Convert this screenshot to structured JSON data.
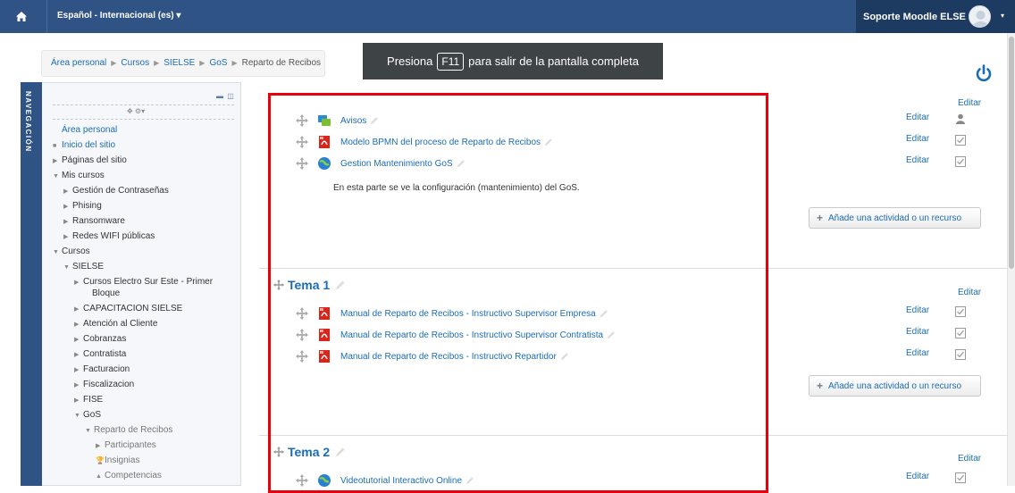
{
  "topbar": {
    "language": "Español - Internacional (es) ▾",
    "user_name": "Soporte Moodle ELSE",
    "user_caret": "▾"
  },
  "breadcrumb": [
    "Área personal",
    "Cursos",
    "SIELSE",
    "GoS",
    "Reparto de Recibos"
  ],
  "fullscreen_banner": {
    "before": "Presiona",
    "key": "F11",
    "after": "para salir de la pantalla completa"
  },
  "navigation": {
    "title": "NAVEGACIÓN",
    "items": [
      {
        "label": "Área personal",
        "marker": ""
      },
      {
        "label": "Inicio del sitio",
        "marker": "■"
      },
      {
        "label": "Páginas del sitio",
        "marker": "▶"
      },
      {
        "label": "Mis cursos",
        "marker": "▼"
      },
      {
        "label": "Gestión de Contraseñas",
        "marker": "▶"
      },
      {
        "label": "Phising",
        "marker": "▶"
      },
      {
        "label": "Ransomware",
        "marker": "▶"
      },
      {
        "label": "Redes WIFI públicas",
        "marker": "▶"
      },
      {
        "label": "Cursos",
        "marker": "▼"
      },
      {
        "label": "SIELSE",
        "marker": "▼"
      },
      {
        "label": "Cursos Electro Sur Este - Primer",
        "marker": "▶"
      },
      {
        "label": "Bloque",
        "marker": ""
      },
      {
        "label": "CAPACITACION SIELSE",
        "marker": "▶"
      },
      {
        "label": "Atención al Cliente",
        "marker": "▶"
      },
      {
        "label": "Cobranzas",
        "marker": "▶"
      },
      {
        "label": "Contratista",
        "marker": "▶"
      },
      {
        "label": "Facturacion",
        "marker": "▶"
      },
      {
        "label": "Fiscalizacion",
        "marker": "▶"
      },
      {
        "label": "FISE",
        "marker": "▶"
      },
      {
        "label": "GoS",
        "marker": "▼"
      },
      {
        "label": "Reparto de Recibos",
        "marker": "▼"
      },
      {
        "label": "Participantes",
        "marker": "▶"
      },
      {
        "label": "Insignias",
        "marker": ""
      },
      {
        "label": "Competencias",
        "marker": ""
      }
    ]
  },
  "sections": {
    "general": {
      "activities": [
        {
          "name": "Avisos",
          "icon": "forum-icon"
        },
        {
          "name": "Modelo BPMN del proceso de Reparto de Recibos",
          "icon": "pdf-icon"
        },
        {
          "name": "Gestion Mantenimiento GoS",
          "icon": "url-icon"
        }
      ],
      "summary": "En esta parte se ve la configuración (mantenimiento) del GoS."
    },
    "tema1": {
      "title": "Tema 1",
      "activities": [
        {
          "name": "Manual de Reparto de Recibos - Instructivo Supervisor Empresa",
          "icon": "pdf-icon"
        },
        {
          "name": "Manual de Reparto de Recibos - Instructivo Supervisor Contratista",
          "icon": "pdf-icon"
        },
        {
          "name": "Manual de Reparto de Recibos - Instructivo Repartidor",
          "icon": "pdf-icon"
        }
      ]
    },
    "tema2": {
      "title": "Tema 2",
      "activities": [
        {
          "name": "Videotutorial Interactivo Online",
          "icon": "url-icon"
        }
      ]
    }
  },
  "labels": {
    "edit": "Editar",
    "add_activity": "Añade una actividad o un recurso",
    "add_plus": "+"
  },
  "colors": {
    "navbar": "#2f5385",
    "link": "#1b6cb4",
    "highlight_box": "#e8000b"
  }
}
